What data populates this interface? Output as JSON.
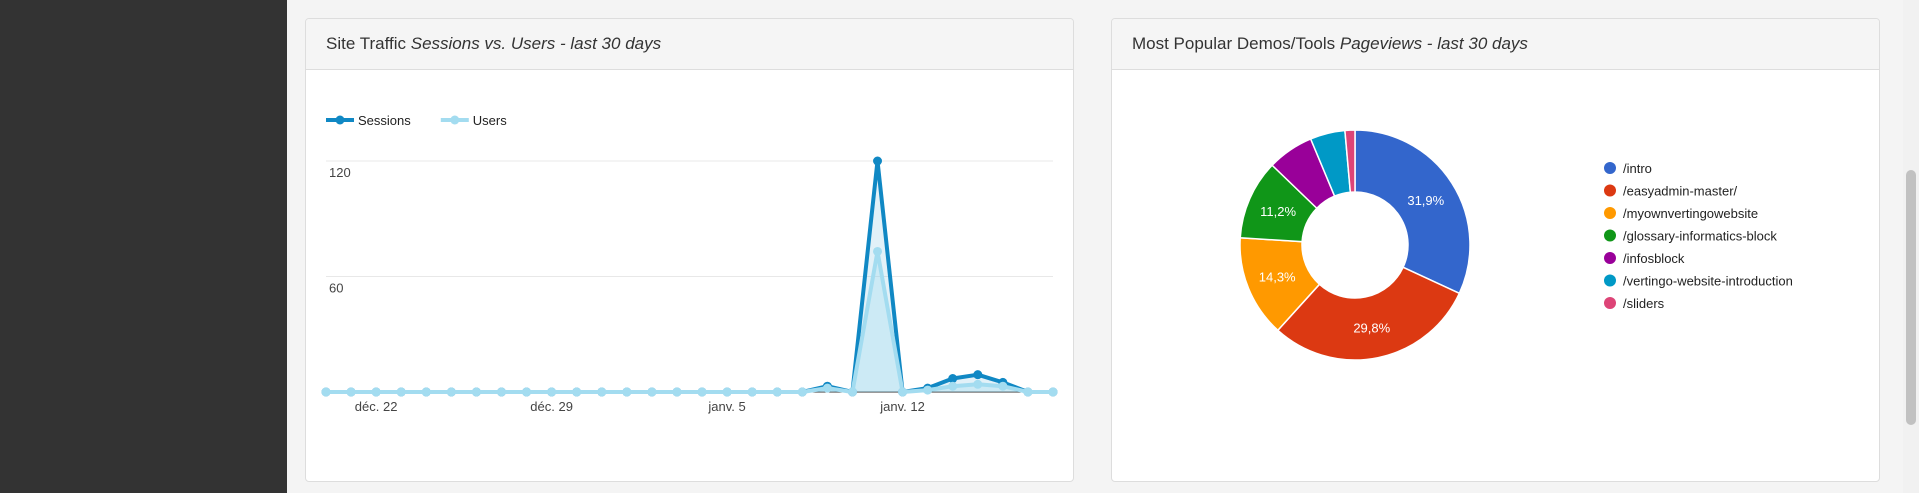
{
  "traffic_panel": {
    "title_plain": "Site Traffic",
    "title_italic": "Sessions vs. Users - last 30 days"
  },
  "popular_panel": {
    "title_plain": "Most Popular Demos/Tools",
    "title_italic": "Pageviews - last 30 days"
  },
  "chart_data": [
    {
      "type": "area",
      "legend_position": "top",
      "grid": true,
      "ylim": [
        0,
        120
      ],
      "y_ticks": [
        60,
        120
      ],
      "x_tick_labels": [
        "déc. 22",
        "déc. 29",
        "janv. 5",
        "janv. 12"
      ],
      "x_tick_indices": [
        2,
        9,
        16,
        23
      ],
      "series": [
        {
          "name": "Sessions",
          "color": "#1088c4",
          "values": [
            0,
            0,
            0,
            0,
            0,
            0,
            0,
            0,
            0,
            0,
            0,
            0,
            0,
            0,
            0,
            0,
            0,
            0,
            0,
            0,
            3,
            0,
            120,
            0,
            2,
            7,
            9,
            5,
            0,
            0
          ]
        },
        {
          "name": "Users",
          "color": "#a3dcf0",
          "values": [
            0,
            0,
            0,
            0,
            0,
            0,
            0,
            0,
            0,
            0,
            0,
            0,
            0,
            0,
            0,
            0,
            0,
            0,
            0,
            0,
            2,
            0,
            73,
            0,
            1,
            3,
            4,
            3,
            0,
            0
          ]
        }
      ]
    },
    {
      "type": "pie",
      "donut": true,
      "legend_position": "right",
      "slices": [
        {
          "label": "/intro",
          "value": 31.9,
          "color": "#3366cc",
          "display": "31,9%"
        },
        {
          "label": "/easyadmin-master/",
          "value": 29.8,
          "color": "#dc3912",
          "display": "29,8%"
        },
        {
          "label": "/myownvertingowebsite",
          "value": 14.3,
          "color": "#ff9900",
          "display": "14,3%"
        },
        {
          "label": "/glossary-informatics-block",
          "value": 11.2,
          "color": "#109618",
          "display": "11,2%"
        },
        {
          "label": "/infosblock",
          "value": 6.5,
          "color": "#990099",
          "display": ""
        },
        {
          "label": "/vertingo-website-introduction",
          "value": 4.9,
          "color": "#0099c6",
          "display": ""
        },
        {
          "label": "/sliders",
          "value": 1.4,
          "color": "#dd4477",
          "display": ""
        }
      ]
    }
  ]
}
